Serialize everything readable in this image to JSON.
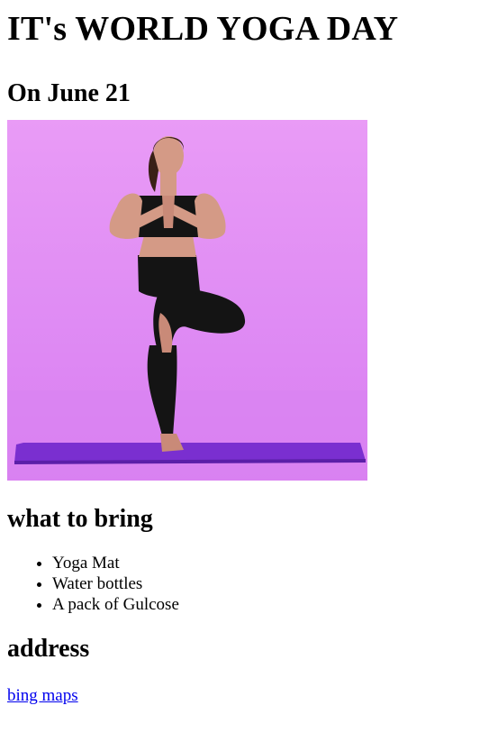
{
  "page": {
    "title": "IT's WORLD YOGA DAY",
    "date_heading": "On June 21"
  },
  "hero_image": {
    "subject": "woman in tree yoga pose on purple mat",
    "background_color": "#e495f5",
    "mat_color": "#7a2fd0"
  },
  "bring": {
    "heading": "what to bring",
    "items": [
      "Yoga Mat",
      "Water bottles",
      "A pack of Gulcose"
    ]
  },
  "address": {
    "heading": "address",
    "link_text": "bing maps",
    "link_color": "#0000ee"
  }
}
